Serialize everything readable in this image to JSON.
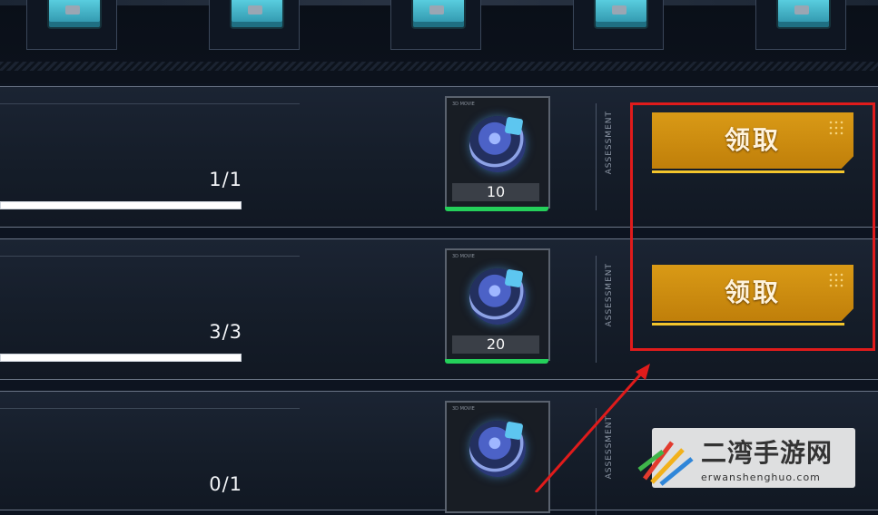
{
  "top_slots": [
    {
      "icon": "supply-crate-icon"
    },
    {
      "icon": "supply-crate-icon"
    },
    {
      "icon": "supply-crate-icon"
    },
    {
      "icon": "supply-crate-icon"
    },
    {
      "icon": "supply-crate-icon"
    }
  ],
  "tasks": [
    {
      "progress_text": "1/1",
      "progress_fraction": 1.0,
      "reward": {
        "icon": "currency-coin-icon",
        "tag": "3D MOVIE",
        "quantity": "10"
      },
      "side_label": "ASSESSMENT",
      "claim_label": "领取"
    },
    {
      "progress_text": "3/3",
      "progress_fraction": 1.0,
      "reward": {
        "icon": "currency-coin-icon",
        "tag": "3D MOVIE",
        "quantity": "20"
      },
      "side_label": "ASSESSMENT",
      "claim_label": "领取"
    },
    {
      "progress_text": "0/1",
      "progress_fraction": 0.0,
      "reward": {
        "icon": "currency-coin-icon",
        "tag": "3D MOVIE",
        "quantity": ""
      },
      "side_label": "ASSESSMENT",
      "claim_label": ""
    }
  ],
  "annotation": {
    "color": "#e01b1b"
  },
  "watermark": {
    "title": "二湾手游网",
    "url": "erwanshenghuo.com"
  },
  "colors": {
    "claim_gold": "#d99a16",
    "progress_green": "#24d05a",
    "background": "#0d1420"
  }
}
